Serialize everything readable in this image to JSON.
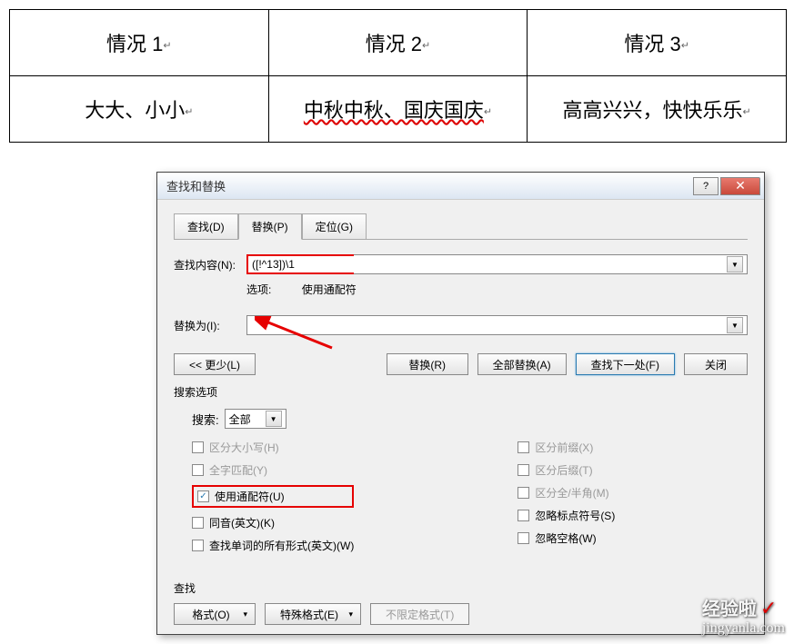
{
  "table": {
    "headers": [
      "情况 1",
      "情况 2",
      "情况 3"
    ],
    "cells": [
      "大大、小小",
      "中秋中秋、国庆国庆",
      "高高兴兴，快快乐乐"
    ]
  },
  "dialog": {
    "title": "查找和替换",
    "help": "?",
    "close": "✕",
    "tabs": {
      "find": "查找(D)",
      "replace": "替换(P)",
      "goto": "定位(G)"
    },
    "find_label": "查找内容(N):",
    "find_value": "([!^13])\\1",
    "option_label": "选项:",
    "option_value": "使用通配符",
    "replace_label": "替换为(I):",
    "replace_value": "",
    "buttons": {
      "less": "<< 更少(L)",
      "replace": "替换(R)",
      "replace_all": "全部替换(A)",
      "find_next": "查找下一处(F)",
      "close": "关闭"
    },
    "search_options_label": "搜索选项",
    "search_label": "搜索:",
    "search_value": "全部",
    "checkboxes": {
      "left": [
        {
          "label": "区分大小写(H)",
          "checked": false,
          "disabled": true
        },
        {
          "label": "全字匹配(Y)",
          "checked": false,
          "disabled": true
        },
        {
          "label": "使用通配符(U)",
          "checked": true,
          "disabled": false,
          "highlight": true
        },
        {
          "label": "同音(英文)(K)",
          "checked": false,
          "disabled": false
        },
        {
          "label": "查找单词的所有形式(英文)(W)",
          "checked": false,
          "disabled": false
        }
      ],
      "right": [
        {
          "label": "区分前缀(X)",
          "checked": false,
          "disabled": true
        },
        {
          "label": "区分后缀(T)",
          "checked": false,
          "disabled": true
        },
        {
          "label": "区分全/半角(M)",
          "checked": false,
          "disabled": true
        },
        {
          "label": "忽略标点符号(S)",
          "checked": false,
          "disabled": false
        },
        {
          "label": "忽略空格(W)",
          "checked": false,
          "disabled": false
        }
      ]
    },
    "bottom_label": "查找",
    "bottom_buttons": {
      "format": "格式(O)",
      "special": "特殊格式(E)",
      "no_format": "不限定格式(T)"
    }
  },
  "watermark": {
    "top": "经验啦",
    "check": "✓",
    "url": "jingyanla.com"
  }
}
